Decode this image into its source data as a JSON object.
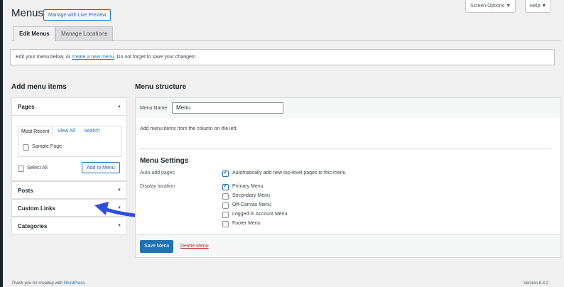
{
  "header": {
    "title": "Menus",
    "live_preview_label": "Manage with Live Preview",
    "screen_options_label": "Screen Options ▼",
    "help_label": "Help ▼"
  },
  "tabs": [
    {
      "label": "Edit Menus"
    },
    {
      "label": "Manage Locations"
    }
  ],
  "notice": {
    "prefix": "Edit your menu below, or ",
    "link": "create a new menu",
    "suffix": ". Do not forget to save your changes!"
  },
  "add_items": {
    "heading": "Add menu items",
    "pages": {
      "title": "Pages",
      "subtabs": [
        "Most Recent",
        "View All",
        "Search"
      ],
      "items": [
        "Sample Page"
      ],
      "select_all": "Select All",
      "add_button": "Add to Menu"
    },
    "sections": [
      "Posts",
      "Custom Links",
      "Categories"
    ]
  },
  "structure": {
    "heading": "Menu structure",
    "menu_name_label": "Menu Name",
    "menu_name_value": "Menu",
    "instructions": "Add menu items from the column on the left.",
    "settings_heading": "Menu Settings",
    "auto_add_label": "Auto add pages",
    "auto_add_option": "Automatically add new top-level pages to this menu",
    "display_location_label": "Display location",
    "locations": [
      {
        "label": "Primary Menu",
        "checked": true
      },
      {
        "label": "Secondary Menu",
        "checked": false
      },
      {
        "label": "Off-Canvas Menu",
        "checked": false
      },
      {
        "label": "Logged In Account Menu",
        "checked": false
      },
      {
        "label": "Footer Menu",
        "checked": false
      }
    ],
    "save_label": "Save Menu",
    "delete_label": "Delete Menu"
  },
  "footer": {
    "thanks_prefix": "Thank you for creating with ",
    "thanks_link": "WordPress",
    "thanks_suffix": ".",
    "version": "Version 6.8.2"
  },
  "colors": {
    "accent": "#2271b1",
    "annotation_arrow": "#2f4fdc",
    "delete": "#b32d2e"
  }
}
